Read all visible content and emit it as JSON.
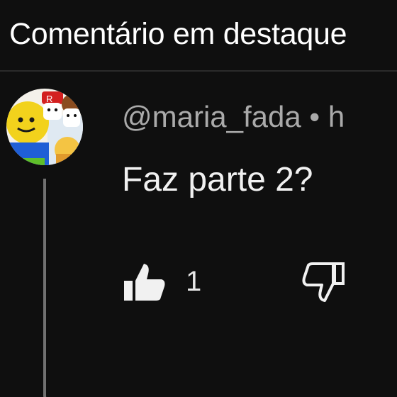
{
  "header": {
    "title": "Comentário em destaque"
  },
  "comment": {
    "author": "@maria_fada",
    "separator": " • ",
    "time_partial": "h",
    "text": "Faz parte 2?",
    "likes": "1",
    "avatar_icon": "roblox-characters-avatar",
    "like_icon": "thumbs-up-filled-icon",
    "dislike_icon": "thumbs-down-outline-icon"
  },
  "colors": {
    "background": "#0f0f0f",
    "primary_text": "#f1f1f1",
    "secondary_text": "#aaaaaa",
    "thread_line": "#717171"
  }
}
